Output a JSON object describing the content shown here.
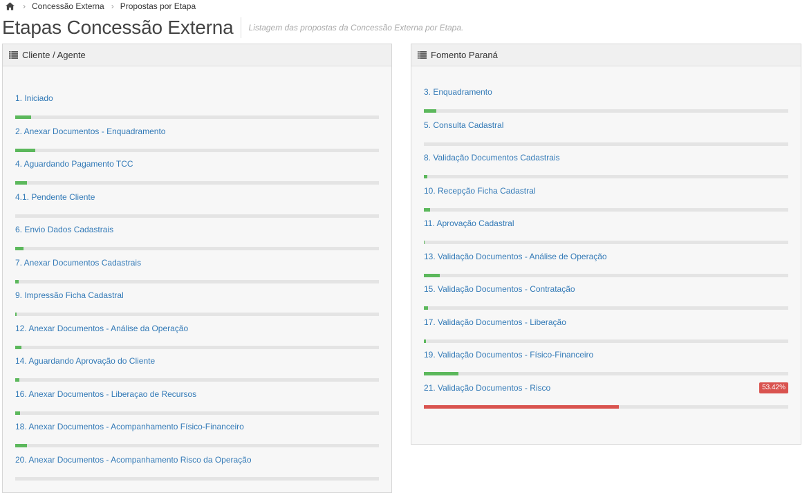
{
  "breadcrumb": {
    "items": [
      "Concessão Externa",
      "Propostas por Etapa"
    ]
  },
  "header": {
    "title": "Etapas Concessão Externa",
    "subtitle": "Listagem das propostas da Concessão Externa por Etapa."
  },
  "colors": {
    "link": "#337ab7",
    "progress_ok": "#5cb85c",
    "progress_danger": "#d9534f",
    "track": "#e4e4e4"
  },
  "left_panel": {
    "title": "Cliente / Agente",
    "icon": "list-icon",
    "steps": [
      {
        "label": "1. Iniciado",
        "progress": 0.044
      },
      {
        "label": "2. Anexar Documentos - Enquadramento",
        "progress": 0.055
      },
      {
        "label": "4. Aguardando Pagamento TCC",
        "progress": 0.033
      },
      {
        "label": "4.1. Pendente Cliente",
        "progress": 0
      },
      {
        "label": "6. Envio Dados Cadastrais",
        "progress": 0.023
      },
      {
        "label": "7. Anexar Documentos Cadastrais",
        "progress": 0.009
      },
      {
        "label": "9. Impressão Ficha Cadastral",
        "progress": 0.004
      },
      {
        "label": "12. Anexar Documentos - Análise da Operação",
        "progress": 0.017
      },
      {
        "label": "14. Aguardando Aprovação do Cliente",
        "progress": 0.011
      },
      {
        "label": "16. Anexar Documentos - Liberaçao de Recursos",
        "progress": 0.013
      },
      {
        "label": "18. Anexar Documentos - Acompanhamento Físico-Financeiro",
        "progress": 0.032
      },
      {
        "label": "20. Anexar Documentos - Acompanhamento Risco da Operação",
        "progress": 0
      }
    ]
  },
  "right_panel": {
    "title": "Fomento Paraná",
    "icon": "list-icon",
    "steps": [
      {
        "label": "3. Enquadramento",
        "progress": 0.034
      },
      {
        "label": "5. Consulta Cadastral",
        "progress": 0
      },
      {
        "label": "8. Validação Documentos Cadastrais",
        "progress": 0.009
      },
      {
        "label": "10. Recepção Ficha Cadastral",
        "progress": 0.017
      },
      {
        "label": "11. Aprovação Cadastral",
        "progress": 0.002
      },
      {
        "label": "13. Validação Documentos - Análise de Operação",
        "progress": 0.044
      },
      {
        "label": "15. Validação Documentos - Contratação",
        "progress": 0.011
      },
      {
        "label": "17. Validação Documentos - Liberação",
        "progress": 0.005
      },
      {
        "label": "19. Validação Documentos - Físico-Financeiro",
        "progress": 0.095
      },
      {
        "label": "21. Validação Documentos - Risco",
        "progress": 0.5342,
        "badge": "53.42%",
        "status": "danger"
      }
    ]
  }
}
